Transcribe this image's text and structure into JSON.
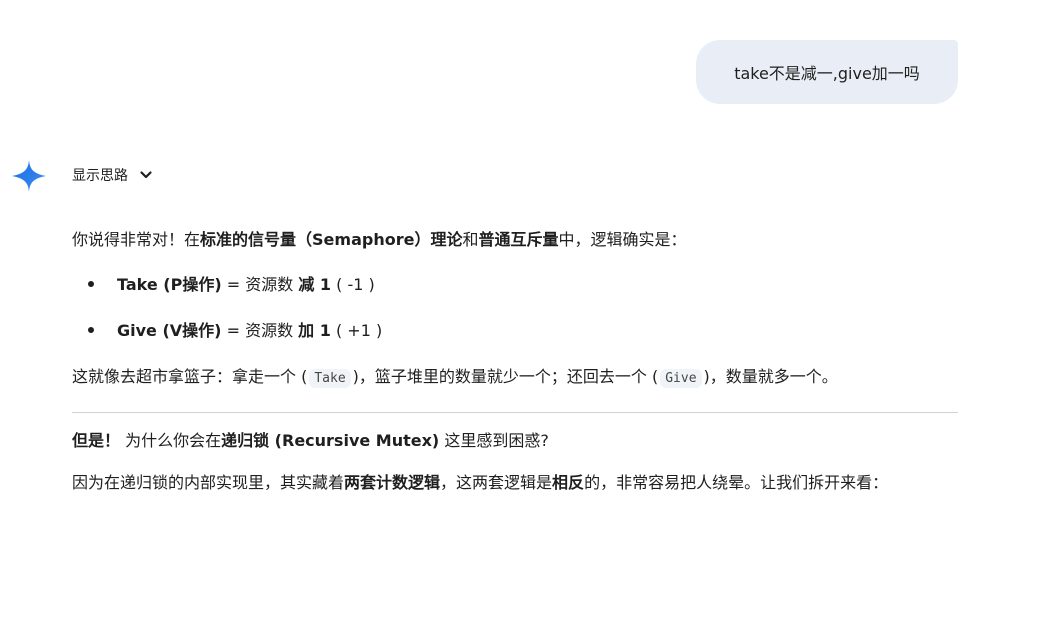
{
  "user_message": "take不是减一,give加一吗",
  "thoughts_toggle": {
    "label": "显示思路"
  },
  "response": {
    "p1": {
      "t1": "你说得非常对！在",
      "b1": "标准的信号量（Semaphore）理论",
      "t2": "和",
      "b2": "普通互斥量",
      "t3": "中，逻辑确实是："
    },
    "bullets": [
      {
        "term": "Take (P操作)",
        "mid": " = 资源数 ",
        "op": "减 1",
        "tail": " ( -1 )"
      },
      {
        "term": "Give (V操作)",
        "mid": " = 资源数 ",
        "op": "加 1",
        "tail": " ( +1 )"
      }
    ],
    "p2": {
      "t1": "这就像去超市拿篮子：拿走一个 (",
      "c1": "Take",
      "t2": ")，篮子堆里的数量就少一个；还回去一个 (",
      "c2": "Give",
      "t3": ")，数量就多一个。"
    },
    "p3": {
      "b1": "但是！",
      "t1": " 为什么你会在",
      "b2": "递归锁 (Recursive Mutex)",
      "t2": " 这里感到困惑?"
    },
    "p4": {
      "t1": "因为在递归锁的内部实现里，其实藏着",
      "b1": "两套计数逻辑",
      "t2": "，这两套逻辑是",
      "b2": "相反",
      "t3": "的，非常容易把人绕晕。让我们拆开来看："
    }
  }
}
